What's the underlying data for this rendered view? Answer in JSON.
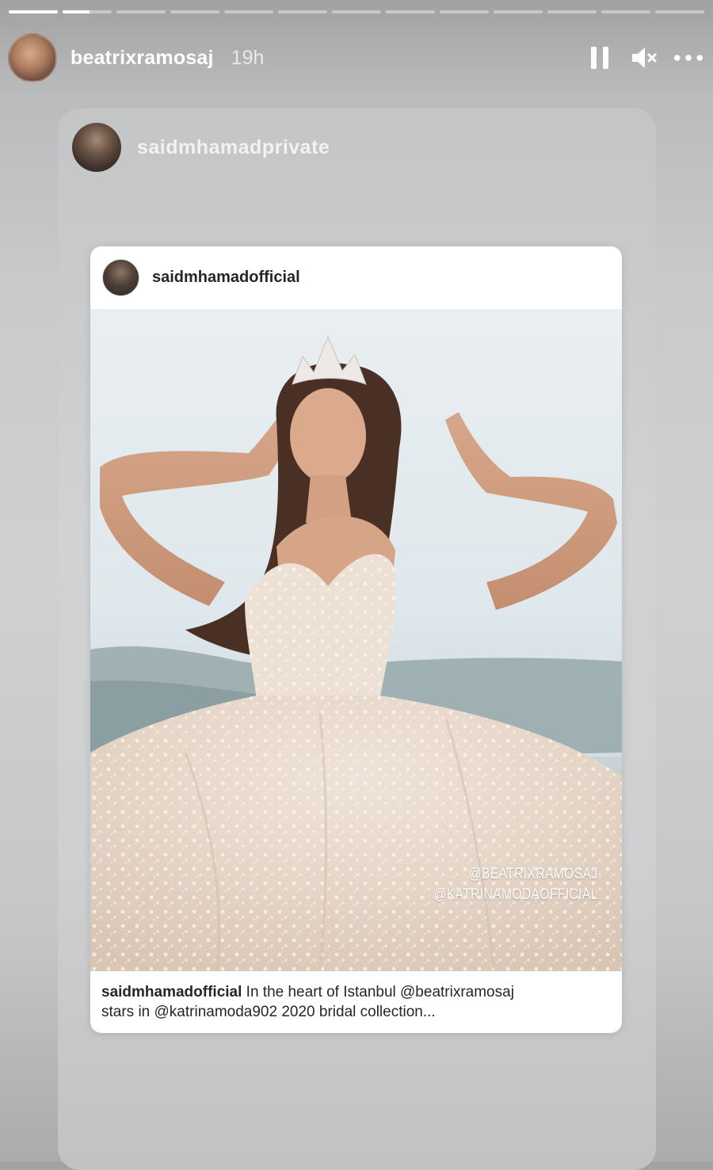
{
  "story": {
    "segments_total": 13,
    "active_segment": 2,
    "active_progress": 0.55,
    "username": "beatrixramosaj",
    "time_ago": "19h"
  },
  "controls": {
    "pause": "pause-icon",
    "mute": "speaker-muted-icon",
    "more": "more-icon"
  },
  "shared": {
    "reposter": "saidmhamadprivate"
  },
  "post": {
    "author": "saidmhamadofficial",
    "watermark_line1": "@BEATRIXRAMOSAJ",
    "watermark_line2": "@KATRINAMODAOFFICIAL",
    "caption_author": "saidmhamadofficial",
    "caption_line1": "In the heart of Istanbul @beatrixramosaj",
    "caption_line2": "stars in @katrinamoda902 2020 bridal collection..."
  },
  "colors": {
    "progress_fill": "#ffffff",
    "progress_track": "rgba(255,255,255,0.4)",
    "post_text": "#262626"
  }
}
